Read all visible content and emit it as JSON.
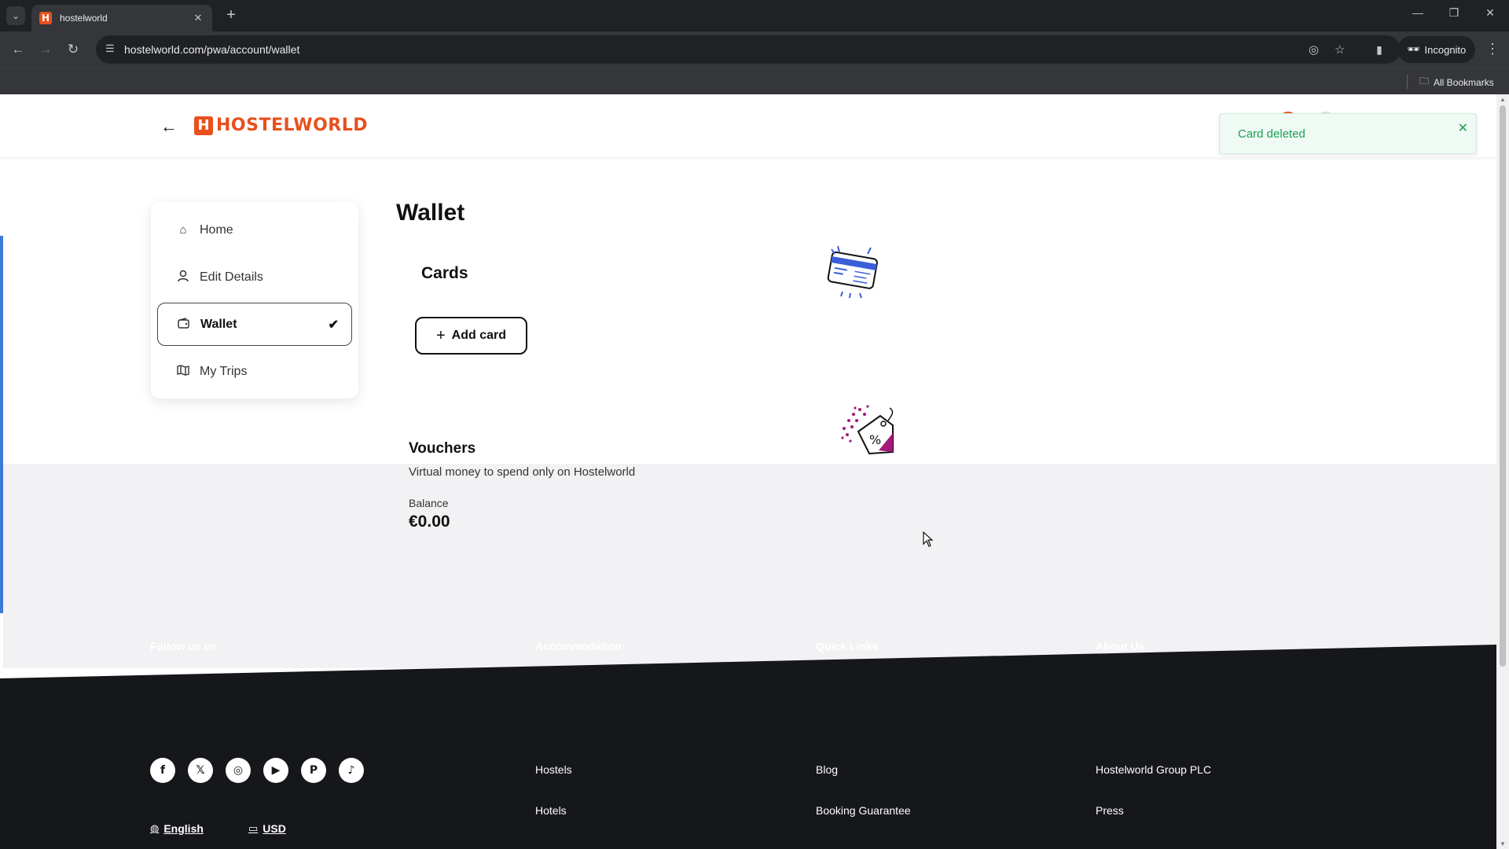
{
  "browser": {
    "tab_title": "hostelworld",
    "tab_favicon": "H",
    "url": "hostelworld.com/pwa/account/wallet",
    "incognito_label": "Incognito",
    "bookmarks_label": "All Bookmarks"
  },
  "header": {
    "logo_mark": "H",
    "logo_text": "HOSTELWORLD"
  },
  "toast": {
    "message": "Card deleted"
  },
  "sidebar": {
    "items": [
      {
        "label": "Home",
        "icon": "home-icon"
      },
      {
        "label": "Edit Details",
        "icon": "person-icon"
      },
      {
        "label": "Wallet",
        "icon": "wallet-icon",
        "active": true
      },
      {
        "label": "My Trips",
        "icon": "map-icon"
      }
    ]
  },
  "main": {
    "title": "Wallet",
    "cards_title": "Cards",
    "add_card_label": "Add card"
  },
  "vouchers": {
    "title": "Vouchers",
    "description": "Virtual money to spend only on Hostelworld",
    "balance_label": "Balance",
    "balance_value": "€0.00"
  },
  "footer": {
    "follow_title": "Follow us on",
    "social": [
      "facebook-icon",
      "x-icon",
      "instagram-icon",
      "youtube-icon",
      "pinterest-icon",
      "tiktok-icon"
    ],
    "language": "English",
    "currency": "USD",
    "accommodation": {
      "title": "Accommodation",
      "links": [
        "Hostels",
        "Hotels"
      ]
    },
    "quick_links": {
      "title": "Quick Links",
      "links": [
        "Blog",
        "Booking Guarantee"
      ]
    },
    "about": {
      "title": "About Us",
      "links": [
        "Hostelworld Group PLC",
        "Press"
      ]
    }
  },
  "colors": {
    "brand": "#e8501c",
    "toast_text": "#1f9d55",
    "footer_bg": "#16171b",
    "voucher_band": "#f2f2f4"
  }
}
